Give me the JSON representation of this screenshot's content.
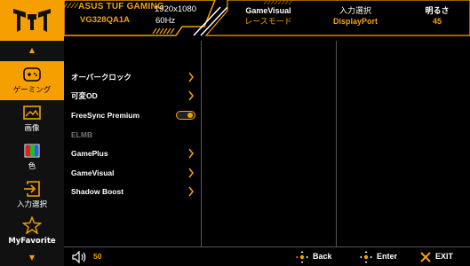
{
  "header": {
    "brand": "ASUS TUF GAMING",
    "model": "VG328QA1A",
    "resolution": "1920x1080",
    "refresh": "60Hz",
    "gamevisual_label": "GameVisual",
    "gamevisual_value": "レースモード",
    "input_label": "入力選択",
    "input_value": "DisplayPort",
    "brightness_label": "明るさ",
    "brightness_value": "45"
  },
  "sidebar": {
    "items": [
      {
        "label": "ゲーミング",
        "icon": "gamepad-icon",
        "active": true
      },
      {
        "label": "画像",
        "icon": "image-icon"
      },
      {
        "label": "色",
        "icon": "color-bars-icon"
      },
      {
        "label": "入力選択",
        "icon": "input-icon"
      },
      {
        "label": "MyFavorite",
        "icon": "star-icon"
      }
    ]
  },
  "menu": {
    "items": [
      {
        "label": "オーバークロック",
        "control": "chevron"
      },
      {
        "label": "可変OD",
        "control": "chevron"
      },
      {
        "label": "FreeSync Premium",
        "control": "toggle",
        "state": "on"
      },
      {
        "label": "ELMB",
        "control": "none",
        "disabled": true
      },
      {
        "label": "GamePlus",
        "control": "chevron"
      },
      {
        "label": "GameVisual",
        "control": "chevron"
      },
      {
        "label": "Shadow Boost",
        "control": "chevron"
      }
    ]
  },
  "footer": {
    "volume": "50",
    "back_label": "Back",
    "enter_label": "Enter",
    "exit_label": "EXIT"
  },
  "colors": {
    "accent": "#f5a000",
    "background": "#000000",
    "divider": "#555555"
  }
}
